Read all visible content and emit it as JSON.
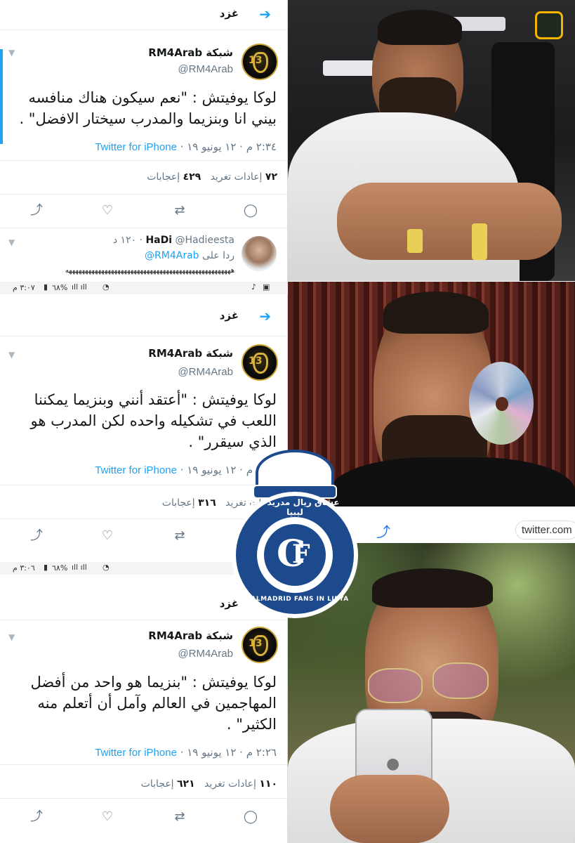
{
  "header": {
    "title": "غزد",
    "back_icon": "arrow-right-icon"
  },
  "tweets": [
    {
      "display_name": "شبكة RM4Arab",
      "handle": "@RM4Arab",
      "text": "لوكا يوفيتش : \"نعم سيكون هناك منافسه بيني انا وبنزيما والمدرب سيختار الافضل\" .",
      "time": "٢:٣٤ م · ١٢ يونيو ١٩ ·",
      "source": "Twitter for iPhone",
      "retweets_count": "٧٢",
      "retweets_label": "إعادات تغريد",
      "likes_count": "٤٢٩",
      "likes_label": "إعجابات"
    },
    {
      "display_name": "شبكة RM4Arab",
      "handle": "@RM4Arab",
      "text": "لوكا يوفيتش : \"أعتقد أنني وبنزيما يمكننا اللعب في تشكيله واحده لكن المدرب هو الذي سيقرر\" .",
      "time": "٢:٣٠ م · ١٢ يونيو ١٩ ·",
      "source": "Twitter for iPhone",
      "retweets_label": "اعادات تغريد",
      "likes_count": "٣١٦",
      "likes_label": "إعجابات"
    },
    {
      "display_name": "شبكة RM4Arab",
      "handle": "@RM4Arab",
      "text": "لوكا يوفيتش : \"بنزيما هو واحد من أفضل المهاجمين في العالم وآمل أن أتعلم منه الكثير\" .",
      "time": "٢:٢٦ م · ١٢ يونيو ١٩ ·",
      "source": "Twitter for iPhone",
      "retweets_count": "١١٠",
      "retweets_label": "إعادات تغريد",
      "likes_count": "٦٢١",
      "likes_label": "إعجابات"
    }
  ],
  "reply": {
    "name": "HaDi",
    "handle": "@Hadieesta",
    "time": "١٢٠ د",
    "reply_to_label": "ردا على",
    "reply_to_handle": "@RM4Arab",
    "text": "هههههههههههههههههههههههههههههههههههههههههههههههههههه"
  },
  "status_bars": [
    {
      "time": "٣:٠٧ م",
      "battery": "٦٨%"
    },
    {
      "time": "٣:٠٦ م",
      "battery": "٦٨%"
    }
  ],
  "action_icons": [
    "share-icon",
    "like-icon",
    "retweet-icon",
    "reply-icon"
  ],
  "photo_panel": {
    "share_label": "twitter.com"
  },
  "watermark": {
    "arabic_text": "عشاق ريال مدريد في ليبيا",
    "english_text": "REALMADRID FANS IN LIBYA"
  },
  "colors": {
    "twitter_blue": "#1da1f2",
    "text": "#14171a",
    "muted": "#657786",
    "badge_navy": "#1c4a8c"
  }
}
